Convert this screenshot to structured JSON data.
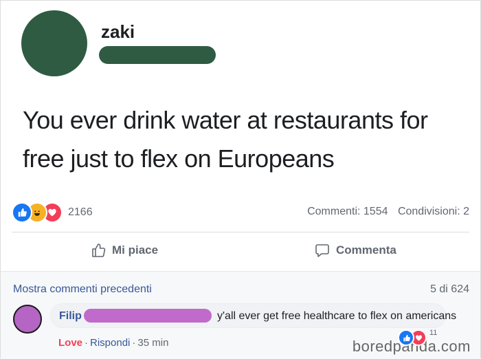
{
  "post": {
    "author": "zaki",
    "text": "You ever drink water at restaurants for free just to flex on Europeans",
    "reaction_count": "2166",
    "comments_label": "Commenti: 1554",
    "shares_label": "Condivisioni: 2",
    "reactions": [
      "like",
      "haha",
      "love"
    ],
    "colors": {
      "avatar": "#2f5b43",
      "like": "#1877f2",
      "haha": "#f7b125",
      "love": "#f33e58"
    }
  },
  "actions": {
    "like_label": "Mi piace",
    "comment_label": "Commenta"
  },
  "comments": {
    "more_label": "Mostra commenti precedenti",
    "page_label": "5 di 624",
    "items": [
      {
        "author": "Filip",
        "text": "y'all ever get free healthcare to flex on americans",
        "reaction_label": "Love",
        "reply_label": "Rispondi",
        "time": "35 min",
        "reaction_count": "11",
        "reactions": [
          "like",
          "love"
        ]
      }
    ]
  },
  "watermark": "boredpanda.com"
}
